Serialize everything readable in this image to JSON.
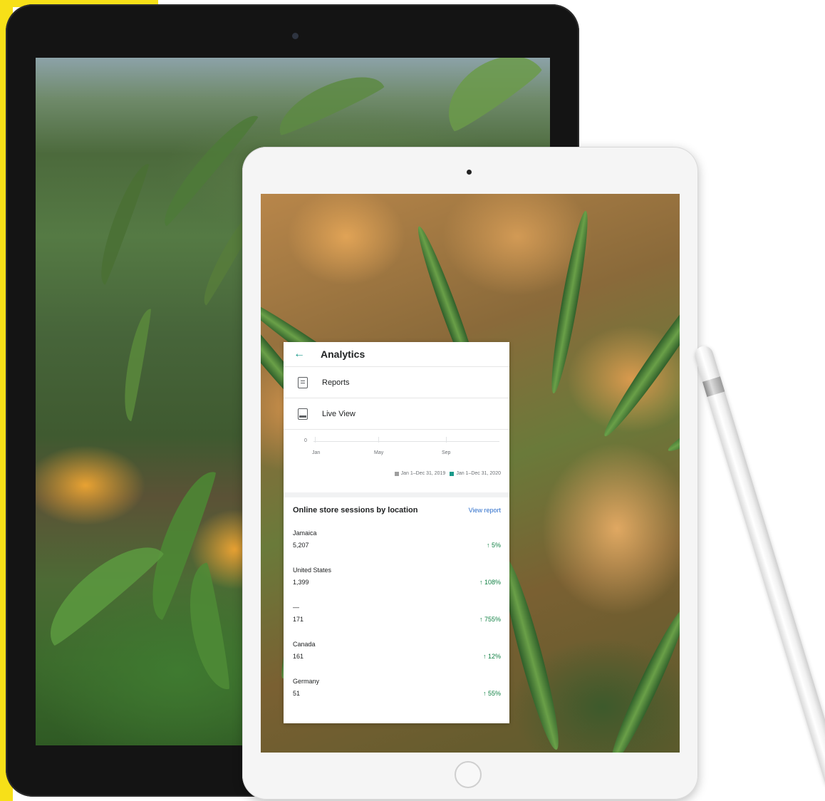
{
  "analytics": {
    "title": "Analytics",
    "menu": [
      {
        "label": "Reports",
        "icon": "reports-icon"
      },
      {
        "label": "Live View",
        "icon": "live-view-icon"
      }
    ],
    "chart": {
      "y_zero_label": "0",
      "x_labels": [
        "Jan",
        "May",
        "Sep"
      ],
      "legend": [
        {
          "label": "Jan 1–Dec 31, 2019",
          "color": "#9e9e9e"
        },
        {
          "label": "Jan 1–Dec 31, 2020",
          "color": "#1a9a8a"
        }
      ]
    },
    "sessions": {
      "title": "Online store sessions by location",
      "view_report": "View report",
      "rows": [
        {
          "name": "Jamaica",
          "value": "5,207",
          "change": "↑ 5%"
        },
        {
          "name": "United States",
          "value": "1,399",
          "change": "↑ 108%"
        },
        {
          "name": "—",
          "value": "171",
          "change": "↑ 755%"
        },
        {
          "name": "Canada",
          "value": "161",
          "change": "↑ 12%"
        },
        {
          "name": "Germany",
          "value": "51",
          "change": "↑ 55%"
        }
      ]
    }
  },
  "colors": {
    "accent": "#1a9a8a",
    "link": "#2c6ecb",
    "positive": "#108043",
    "brand_yellow": "#f7e018"
  }
}
